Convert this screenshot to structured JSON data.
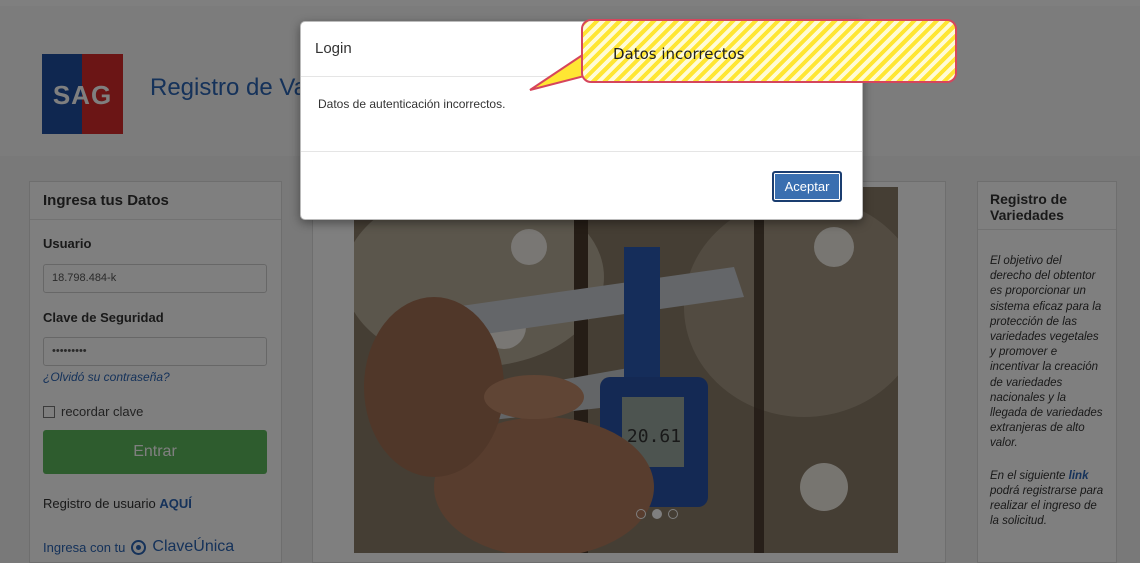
{
  "header": {
    "logo_text": "SAG",
    "site_title": "Registro de Va"
  },
  "login_panel": {
    "title": "Ingresa tus Datos",
    "user_label": "Usuario",
    "user_value": "18.798.484-k",
    "password_label": "Clave de Seguridad",
    "password_value": "•••••••••",
    "forgot_link": "¿Olvidó su contraseña?",
    "remember_label": "recordar clave",
    "enter_button": "Entrar",
    "register_text": "Registro de usuario",
    "register_link": "AQUÍ",
    "clave_prefix": "Ingresa con tu",
    "clave_brand": "ClaveÚnica"
  },
  "right_panel": {
    "title": "Registro de Variedades",
    "paragraph1": "El objetivo del derecho del obtentor es proporcionar un sistema eficaz para la protección de las variedades vegetales y promover e incentivar la creación de variedades nacionales y la llegada de variedades extranjeras de alto valor.",
    "paragraph2_prefix": "En el siguiente",
    "paragraph2_link": "link",
    "paragraph2_suffix": "podrá registrarse para realizar el ingreso de la solicitud."
  },
  "carousel": {
    "active_index": 1,
    "slide_count": 3
  },
  "modal": {
    "title": "Login",
    "message": "Datos de autenticación incorrectos.",
    "accept_button": "Aceptar"
  },
  "annotation": {
    "text": "Datos incorrectos"
  },
  "colors": {
    "link_blue": "#2a64b5",
    "success_green": "#5cb85c",
    "primary_button": "#3a6fb0",
    "callout_border": "#d6455c",
    "callout_yellow": "#ffe633"
  }
}
